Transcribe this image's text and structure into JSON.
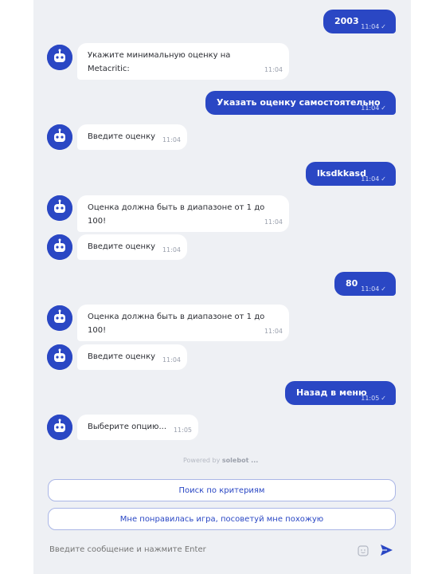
{
  "messages": [
    {
      "from": "user",
      "text": "2003",
      "time": "11:04"
    },
    {
      "from": "bot",
      "lines": [
        "Укажите минимальную оценку на",
        "Metacritic:"
      ],
      "time": "11:04"
    },
    {
      "from": "user",
      "text": "Указать оценку самостоятельно",
      "time": "11:04"
    },
    {
      "from": "bot",
      "lines": [
        "Введите оценку"
      ],
      "time": "11:04"
    },
    {
      "from": "user",
      "text": "lksdkkasd",
      "time": "11:04"
    },
    {
      "from": "bot",
      "lines": [
        "Оценка должна быть в диапазоне от 1 до",
        "100!"
      ],
      "time": "11:04"
    },
    {
      "from": "bot",
      "lines": [
        "Введите оценку"
      ],
      "time": "11:04"
    },
    {
      "from": "user",
      "text": "80",
      "time": "11:04"
    },
    {
      "from": "bot",
      "lines": [
        "Оценка должна быть в диапазоне от 1 до",
        "100!"
      ],
      "time": "11:04"
    },
    {
      "from": "bot",
      "lines": [
        "Введите оценку"
      ],
      "time": "11:04"
    },
    {
      "from": "user",
      "text": "Назад в меню",
      "time": "11:05"
    },
    {
      "from": "bot",
      "lines": [
        "Выберите опцию..."
      ],
      "time": "11:05"
    }
  ],
  "powered": {
    "prefix": "Powered by",
    "brand": "solebot ..."
  },
  "quick_replies": [
    "Поиск по критериям",
    "Мне понравилась игра, посоветуй мне похожую"
  ],
  "input": {
    "placeholder": "Введите сообщение и нажмите Enter"
  },
  "colors": {
    "accent": "#2a47c4",
    "background": "#eef0f4",
    "bubble_bot": "#ffffff"
  },
  "icons": {
    "avatar": "bot-icon",
    "emoji": "emoji-icon",
    "send": "send-icon",
    "read": "check-icon"
  }
}
